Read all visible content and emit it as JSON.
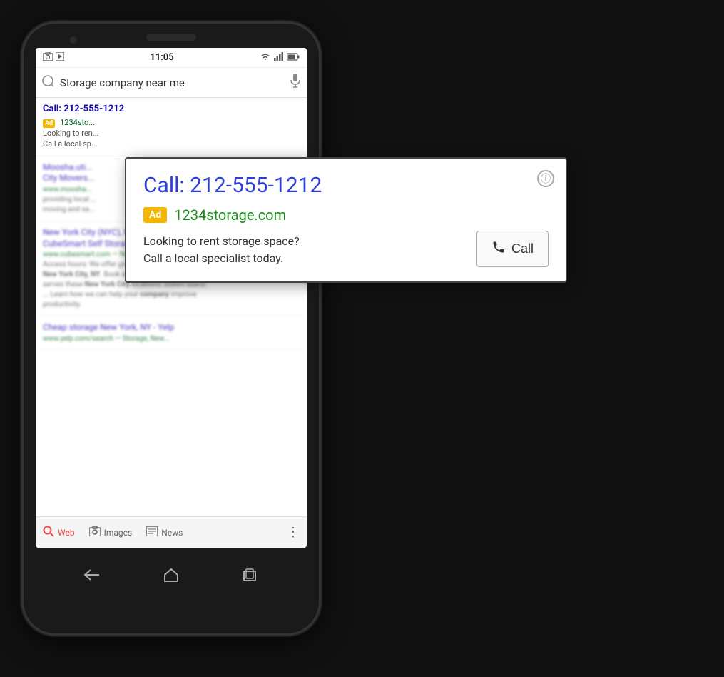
{
  "phone": {
    "status_bar": {
      "time": "11:05",
      "icons_left": [
        "photo",
        "play"
      ],
      "icons_right": [
        "wifi",
        "signal",
        "battery"
      ]
    },
    "search": {
      "placeholder": "Storage company near me",
      "query": "Storage company near me"
    },
    "ad_result": {
      "phone_link": "Call: 212-555-1212",
      "ad_label": "Ad",
      "url": "1234sto...",
      "desc_line1": "Looking to ren...",
      "desc_line2": "Call a local sp..."
    },
    "organic_results": [
      {
        "title": "Moosha.uti...",
        "subtitle": "City Movers...",
        "url": "www.moosha...",
        "desc": "providing local ... moving and sa..."
      },
      {
        "title": "New York City (NYC), NY Storage Units | CubeSmart Self Storage",
        "url": "www.cubesmart.com — New York",
        "desc": "Access hours: We offer great Storage Prices in New York City, NY. Book a unit... CubeSmart also serves these New York City locations: Staten Island ... Learn how we can help your company improve productivity."
      },
      {
        "title": "Cheap storage New York, NY - Yelp",
        "url": "www.yelp.com/search — Storage, New...",
        "desc": ""
      }
    ],
    "tab_bar": {
      "tabs": [
        {
          "label": "Web",
          "icon": "search",
          "active": true
        },
        {
          "label": "Images",
          "icon": "camera"
        },
        {
          "label": "News",
          "icon": "newspaper"
        }
      ],
      "more_icon": "⋮"
    }
  },
  "ad_card": {
    "phone_number": "Call: 212-555-1212",
    "ad_label": "Ad",
    "website": "1234storage.com",
    "description": "Looking to rent storage space?\nCall a local specialist today.",
    "call_button": "Call",
    "info_tooltip": "ⓘ"
  }
}
